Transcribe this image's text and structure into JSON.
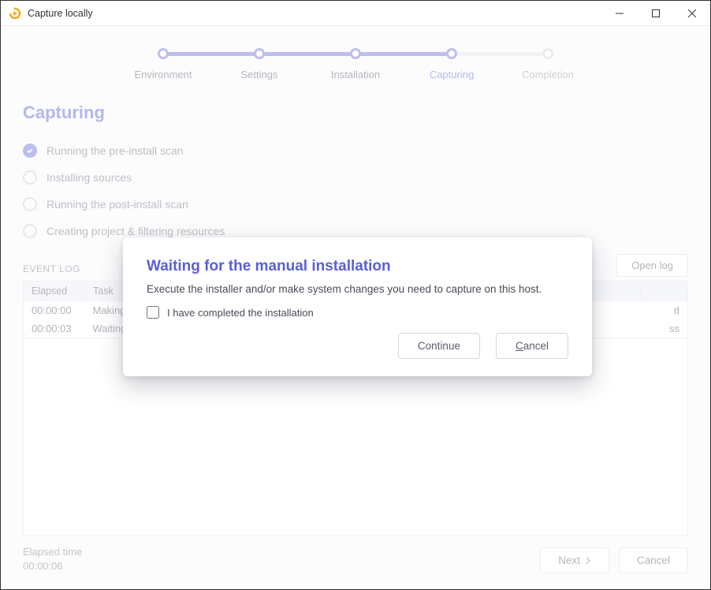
{
  "window": {
    "title": "Capture locally"
  },
  "stepper": {
    "steps": [
      {
        "label": "Environment",
        "state": "done"
      },
      {
        "label": "Settings",
        "state": "done"
      },
      {
        "label": "Installation",
        "state": "done"
      },
      {
        "label": "Capturing",
        "state": "active"
      },
      {
        "label": "Completion",
        "state": "inactive"
      }
    ]
  },
  "page": {
    "heading": "Capturing"
  },
  "checklist": [
    {
      "label": "Running the pre-install scan",
      "done": true
    },
    {
      "label": "Installing sources",
      "done": false
    },
    {
      "label": "Running the post-install scan",
      "done": false
    },
    {
      "label": "Creating project & filtering resources",
      "done": false
    }
  ],
  "eventlog": {
    "section_label": "EVENT LOG",
    "open_log_label": "Open log",
    "columns": {
      "elapsed": "Elapsed",
      "task": "Task",
      "status": ""
    },
    "rows": [
      {
        "elapsed": "00:00:00",
        "task": "Making",
        "status": "d"
      },
      {
        "elapsed": "00:00:03",
        "task": "Waiting",
        "status": "ss"
      }
    ]
  },
  "footer": {
    "elapsed_label": "Elapsed time",
    "elapsed_value": "00:00:06",
    "next_label": "Next",
    "cancel_label": "Cancel"
  },
  "modal": {
    "title": "Waiting for the manual installation",
    "body": "Execute the installer and/or make system changes you need to capture on this host.",
    "checkbox_label": "I have completed the installation",
    "checkbox_checked": false,
    "continue_label": "Continue",
    "cancel_label": "Cancel"
  }
}
